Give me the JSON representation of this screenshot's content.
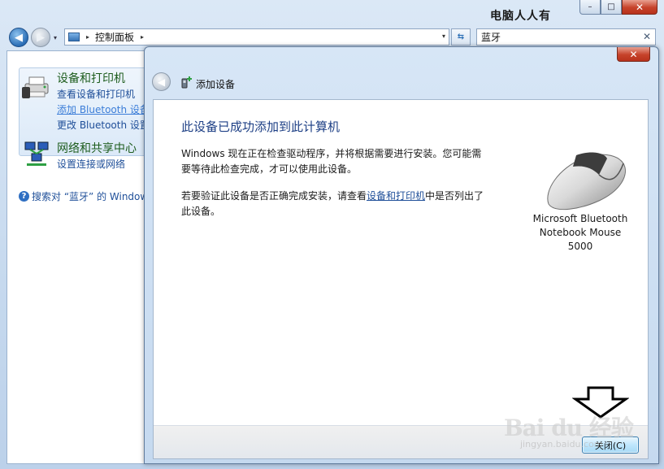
{
  "watermark_top": "电脑人人有",
  "window": {
    "controls": {
      "minimize": "–",
      "maximize": "□",
      "close": "✕"
    }
  },
  "address_bar": {
    "path": "控制面板",
    "sep_glyph": "▸",
    "dropdown_glyph": "▾"
  },
  "search": {
    "value": "蓝牙",
    "clear_glyph": "✕"
  },
  "left_pane": {
    "group1": {
      "title": "设备和打印机",
      "links": [
        "查看设备和打印机",
        "添加 Bluetooth 设备",
        "更改 Bluetooth 设置"
      ]
    },
    "group2": {
      "title": "网络和共享中心",
      "links": [
        "设置连接或网络"
      ]
    },
    "help_link": "搜索对 “蓝牙” 的 Windows 帮助和支持"
  },
  "dialog": {
    "close_glyph": "✕",
    "title": "添加设备",
    "heading": "此设备已成功添加到此计算机",
    "paragraph1": "Windows 现在正在检查驱动程序，并将根据需要进行安装。您可能需要等待此检查完成，才可以使用此设备。",
    "paragraph2_before": "若要验证此设备是否正确完成安装，请查看",
    "paragraph2_link": "设备和打印机",
    "paragraph2_after": "中是否列出了此设备。",
    "device_name": [
      "Microsoft Bluetooth",
      "Notebook Mouse",
      "5000"
    ],
    "close_button": "关闭(C)"
  },
  "watermark_bottom": {
    "logo": "Bai du 经验",
    "url": "jingyan.baidu.com"
  },
  "colors": {
    "heading": "#1d3f85",
    "link": "#1f4f99",
    "group_title": "#1e5d1e",
    "close_red": "#c6422a"
  }
}
